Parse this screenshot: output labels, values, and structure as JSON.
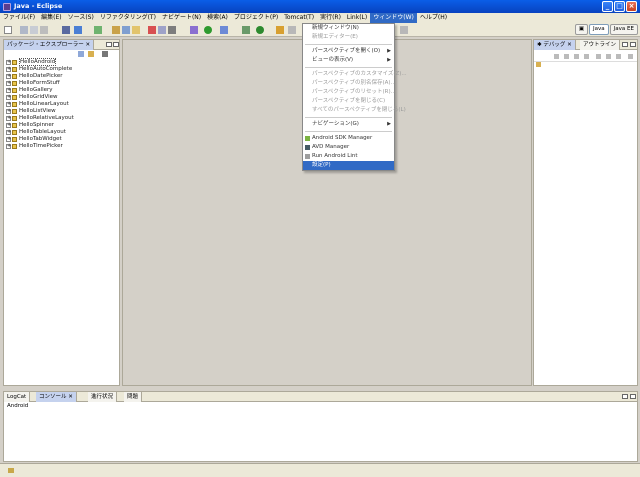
{
  "window": {
    "title": "Java - Eclipse"
  },
  "menubar": {
    "items": [
      "ファイル(F)",
      "編集(E)",
      "ソース(S)",
      "リファクタリング(T)",
      "ナビゲート(N)",
      "検索(A)",
      "プロジェクト(P)",
      "Tomcat(T)",
      "実行(R)",
      "Link(L)",
      "ウィンドウ(W)",
      "ヘルプ(H)"
    ],
    "open_index": 10
  },
  "perspectives": {
    "java": "Java",
    "java_ee": "Java EE"
  },
  "explorer": {
    "title": "パッケージ・エクスプローラー",
    "projects": [
      "HelloAndroid",
      "HelloAutoComplete",
      "HelloDatePicker",
      "HelloFormStuff",
      "HelloGallery",
      "HelloGridView",
      "HelloLinearLayout",
      "HelloListView",
      "HelloRelativeLayout",
      "HelloSpinner",
      "HelloTableLayout",
      "HelloTabWidget",
      "HelloTimePicker"
    ]
  },
  "debug_panel": {
    "tab_debug": "デバッグ",
    "tab_outline": "アウトライン"
  },
  "window_menu": {
    "items": [
      {
        "label": "新規ウィンドウ(N)",
        "disabled": false
      },
      {
        "label": "新規エディター(E)",
        "disabled": true
      },
      {
        "sep": true
      },
      {
        "label": "パースペクティブを開く(O)",
        "sub": true
      },
      {
        "label": "ビューの表示(V)",
        "sub": true
      },
      {
        "sep": true
      },
      {
        "label": "パースペクティブのカスタマイズ(Z)...",
        "disabled": true
      },
      {
        "label": "パースペクティブの別名保存(A)...",
        "disabled": true
      },
      {
        "label": "パースペクティブのリセット(R)...",
        "disabled": true
      },
      {
        "label": "パースペクティブを閉じる(C)",
        "disabled": true
      },
      {
        "label": "すべてのパースペクティブを閉じる(L)",
        "disabled": true
      },
      {
        "sep": true
      },
      {
        "label": "ナビゲーション(G)",
        "sub": true
      },
      {
        "sep": true
      },
      {
        "label": "Android SDK Manager",
        "icon": "android-icon"
      },
      {
        "label": "AVD Manager",
        "icon": "phone-icon"
      },
      {
        "label": "Run Android Lint",
        "icon": "checkbox-icon"
      },
      {
        "label": "設定(P)",
        "selected": true
      }
    ]
  },
  "bottom_panel": {
    "tabs": [
      "LogCat",
      "コンソール",
      "進行状況",
      "問題"
    ],
    "console_label": "Android"
  },
  "colors": {
    "title_blue": "#0a5ee8",
    "menu_highlight": "#316ac5",
    "tab_blue": "#c5d2ee"
  }
}
